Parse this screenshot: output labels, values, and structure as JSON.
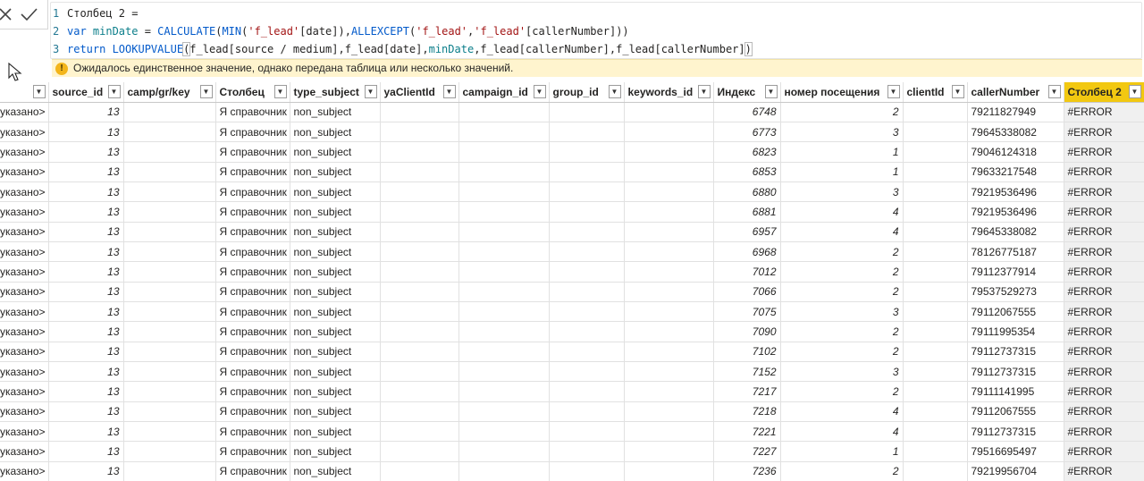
{
  "formula": {
    "lines": [
      {
        "num": "1",
        "parts": [
          {
            "t": "Столбец 2 =",
            "c": ""
          }
        ]
      },
      {
        "num": "2",
        "parts": [
          {
            "t": "var ",
            "c": "kw"
          },
          {
            "t": "minDate",
            "c": "var"
          },
          {
            "t": " = ",
            "c": ""
          },
          {
            "t": "CALCULATE",
            "c": "fn"
          },
          {
            "t": "(",
            "c": ""
          },
          {
            "t": "MIN",
            "c": "fn"
          },
          {
            "t": "(",
            "c": ""
          },
          {
            "t": "'f_lead'",
            "c": "str"
          },
          {
            "t": "[date]),",
            "c": ""
          },
          {
            "t": "ALLEXCEPT",
            "c": "fn"
          },
          {
            "t": "(",
            "c": ""
          },
          {
            "t": "'f_lead'",
            "c": "str"
          },
          {
            "t": ",",
            "c": ""
          },
          {
            "t": "'f_lead'",
            "c": "str"
          },
          {
            "t": "[callerNumber]))",
            "c": ""
          }
        ]
      },
      {
        "num": "3",
        "parts": [
          {
            "t": "return ",
            "c": "kw"
          },
          {
            "t": "LOOKUPVALUE",
            "c": "fn"
          },
          {
            "t": "(",
            "c": "hl"
          },
          {
            "t": "f_lead[source / medium],f_lead[date],",
            "c": ""
          },
          {
            "t": "minDate",
            "c": "var"
          },
          {
            "t": ",f_lead[callerNumber],f_lead[callerNumber]",
            "c": ""
          },
          {
            "t": ")",
            "c": "hl"
          }
        ]
      }
    ]
  },
  "error": {
    "icon": "warning-icon",
    "message": "Ожидалось единственное значение, однако передана таблица или несколько значений."
  },
  "colors": {
    "active_header": "#f2c811",
    "warning_bg": "#fff4ce",
    "keyword": "#035aca",
    "string": "#a31515"
  },
  "table": {
    "columns": [
      "",
      "source_id",
      "camp/gr/key",
      "Столбец",
      "type_subject",
      "yaClientId",
      "campaign_id",
      "group_id",
      "keywords_id",
      "Индекс",
      "номер посещения",
      "clientId",
      "callerNumber",
      "Столбец 2"
    ],
    "rows": [
      [
        "указано>",
        "13",
        "",
        "Я справочник",
        "non_subject",
        "",
        "",
        "",
        "",
        "6748",
        "2",
        "",
        "79211827949",
        "#ERROR"
      ],
      [
        "указано>",
        "13",
        "",
        "Я справочник",
        "non_subject",
        "",
        "",
        "",
        "",
        "6773",
        "3",
        "",
        "79645338082",
        "#ERROR"
      ],
      [
        "указано>",
        "13",
        "",
        "Я справочник",
        "non_subject",
        "",
        "",
        "",
        "",
        "6823",
        "1",
        "",
        "79046124318",
        "#ERROR"
      ],
      [
        "указано>",
        "13",
        "",
        "Я справочник",
        "non_subject",
        "",
        "",
        "",
        "",
        "6853",
        "1",
        "",
        "79633217548",
        "#ERROR"
      ],
      [
        "указано>",
        "13",
        "",
        "Я справочник",
        "non_subject",
        "",
        "",
        "",
        "",
        "6880",
        "3",
        "",
        "79219536496",
        "#ERROR"
      ],
      [
        "указано>",
        "13",
        "",
        "Я справочник",
        "non_subject",
        "",
        "",
        "",
        "",
        "6881",
        "4",
        "",
        "79219536496",
        "#ERROR"
      ],
      [
        "указано>",
        "13",
        "",
        "Я справочник",
        "non_subject",
        "",
        "",
        "",
        "",
        "6957",
        "4",
        "",
        "79645338082",
        "#ERROR"
      ],
      [
        "указано>",
        "13",
        "",
        "Я справочник",
        "non_subject",
        "",
        "",
        "",
        "",
        "6968",
        "2",
        "",
        "78126775187",
        "#ERROR"
      ],
      [
        "указано>",
        "13",
        "",
        "Я справочник",
        "non_subject",
        "",
        "",
        "",
        "",
        "7012",
        "2",
        "",
        "79112377914",
        "#ERROR"
      ],
      [
        "указано>",
        "13",
        "",
        "Я справочник",
        "non_subject",
        "",
        "",
        "",
        "",
        "7066",
        "2",
        "",
        "79537529273",
        "#ERROR"
      ],
      [
        "указано>",
        "13",
        "",
        "Я справочник",
        "non_subject",
        "",
        "",
        "",
        "",
        "7075",
        "3",
        "",
        "79112067555",
        "#ERROR"
      ],
      [
        "указано>",
        "13",
        "",
        "Я справочник",
        "non_subject",
        "",
        "",
        "",
        "",
        "7090",
        "2",
        "",
        "79111995354",
        "#ERROR"
      ],
      [
        "указано>",
        "13",
        "",
        "Я справочник",
        "non_subject",
        "",
        "",
        "",
        "",
        "7102",
        "2",
        "",
        "79112737315",
        "#ERROR"
      ],
      [
        "указано>",
        "13",
        "",
        "Я справочник",
        "non_subject",
        "",
        "",
        "",
        "",
        "7152",
        "3",
        "",
        "79112737315",
        "#ERROR"
      ],
      [
        "указано>",
        "13",
        "",
        "Я справочник",
        "non_subject",
        "",
        "",
        "",
        "",
        "7217",
        "2",
        "",
        "79111141995",
        "#ERROR"
      ],
      [
        "указано>",
        "13",
        "",
        "Я справочник",
        "non_subject",
        "",
        "",
        "",
        "",
        "7218",
        "4",
        "",
        "79112067555",
        "#ERROR"
      ],
      [
        "указано>",
        "13",
        "",
        "Я справочник",
        "non_subject",
        "",
        "",
        "",
        "",
        "7221",
        "4",
        "",
        "79112737315",
        "#ERROR"
      ],
      [
        "указано>",
        "13",
        "",
        "Я справочник",
        "non_subject",
        "",
        "",
        "",
        "",
        "7227",
        "1",
        "",
        "79516695497",
        "#ERROR"
      ],
      [
        "указано>",
        "13",
        "",
        "Я справочник",
        "non_subject",
        "",
        "",
        "",
        "",
        "7236",
        "2",
        "",
        "79219956704",
        "#ERROR"
      ]
    ]
  }
}
